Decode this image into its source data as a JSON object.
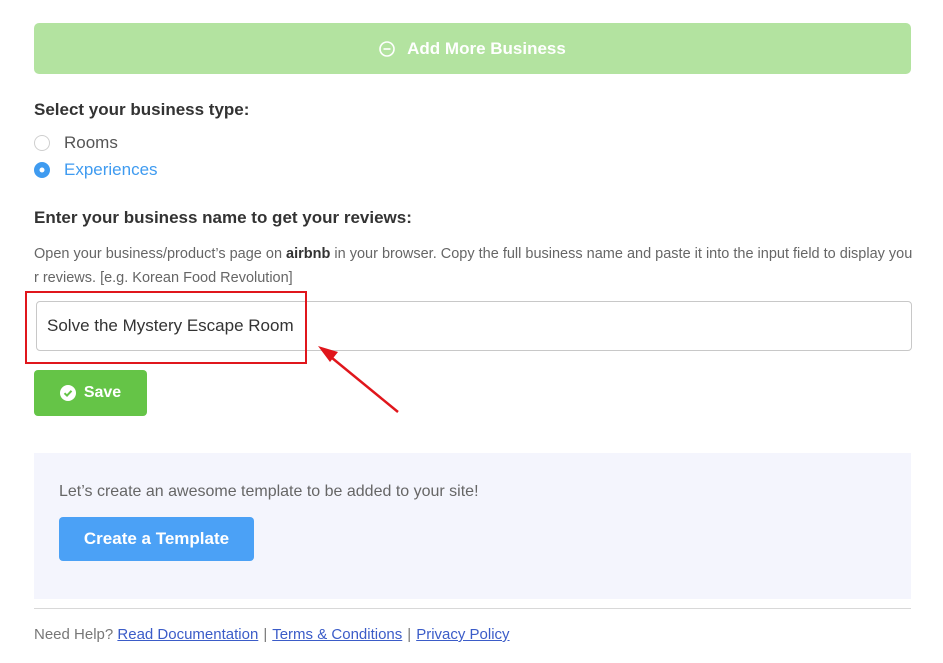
{
  "add_more": {
    "label": "Add More Business",
    "icon": "minus-circle-icon"
  },
  "business_type": {
    "heading": "Select your business type:",
    "options": [
      {
        "label": "Rooms",
        "selected": false
      },
      {
        "label": "Experiences",
        "selected": true
      }
    ]
  },
  "business_name": {
    "heading": "Enter your business name to get your reviews:",
    "help_prefix": "Open your business/product’s page on ",
    "help_bold": "airbnb",
    "help_suffix": " in your browser. Copy the full business name and paste it into the input field to display your reviews. [e.g. Korean Food Revolution]",
    "input_value": "Solve the Mystery Escape Room"
  },
  "save": {
    "label": "Save",
    "icon": "check-circle-icon"
  },
  "template": {
    "text": "Let’s create an awesome template to be added to your site!",
    "button_label": "Create a Template"
  },
  "footer": {
    "prefix": "Need Help?",
    "links": [
      "Read Documentation",
      "Terms & Conditions",
      "Privacy Policy"
    ],
    "separator": "|"
  },
  "colors": {
    "add_more_bg": "#b3e3a0",
    "selected_blue": "#3f9bf0",
    "save_green": "#65c447",
    "create_blue": "#4ba1f6",
    "annotation_red": "#e0161c"
  }
}
